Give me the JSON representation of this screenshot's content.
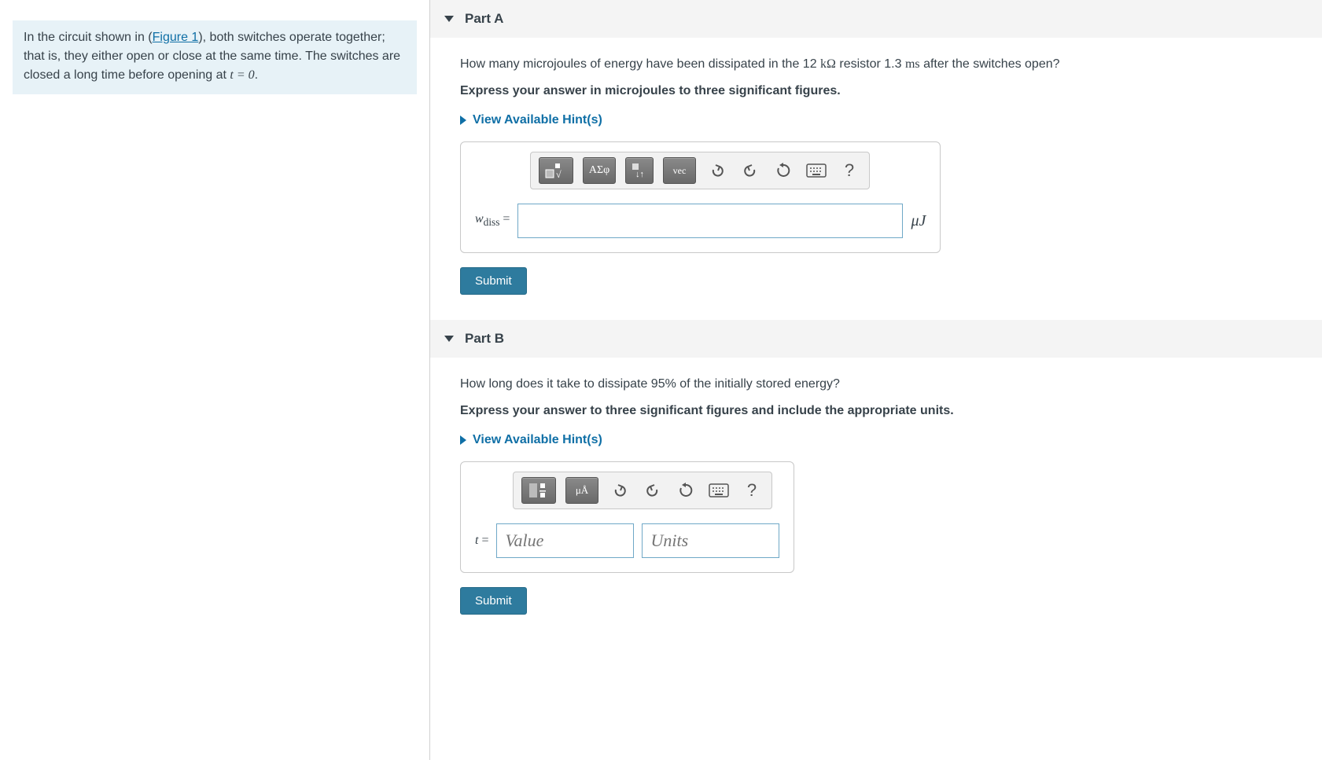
{
  "problem": {
    "text_prefix": "In the circuit shown in (",
    "figure_link": "Figure 1",
    "text_suffix": "), both switches operate together; that is, they either open or close at the same time. The switches are closed a long time before opening at ",
    "equation": "t = 0",
    "text_end": "."
  },
  "partA": {
    "title": "Part A",
    "question_prefix": "How many microjoules of energy have been dissipated in the 12 ",
    "kohm": "kΩ",
    "question_mid": " resistor 1.3 ",
    "ms": "ms",
    "question_suffix": " after the switches open?",
    "instruction": "Express your answer in microjoules to three significant figures.",
    "hints": "View Available Hint(s)",
    "tb_template": "",
    "tb_sqrt": "√",
    "tb_greek": "ΑΣφ",
    "tb_updown": "↓↑",
    "tb_vec": "vec",
    "answer_label_var": "w",
    "answer_label_sub": "diss",
    "answer_label_eq": " = ",
    "unit": "μJ",
    "submit": "Submit"
  },
  "partB": {
    "title": "Part B",
    "question": "How long does it take to dissipate 95% of the initially stored energy?",
    "instruction": "Express your answer to three significant figures and include the appropriate units.",
    "hints": "View Available Hint(s)",
    "tb_units": "μÅ",
    "answer_label": "t = ",
    "value_placeholder": "Value",
    "units_placeholder": "Units",
    "submit": "Submit"
  },
  "icons": {
    "undo": "↶",
    "redo": "↷",
    "reset": "↻",
    "keyboard": "⌨",
    "help": "?"
  }
}
